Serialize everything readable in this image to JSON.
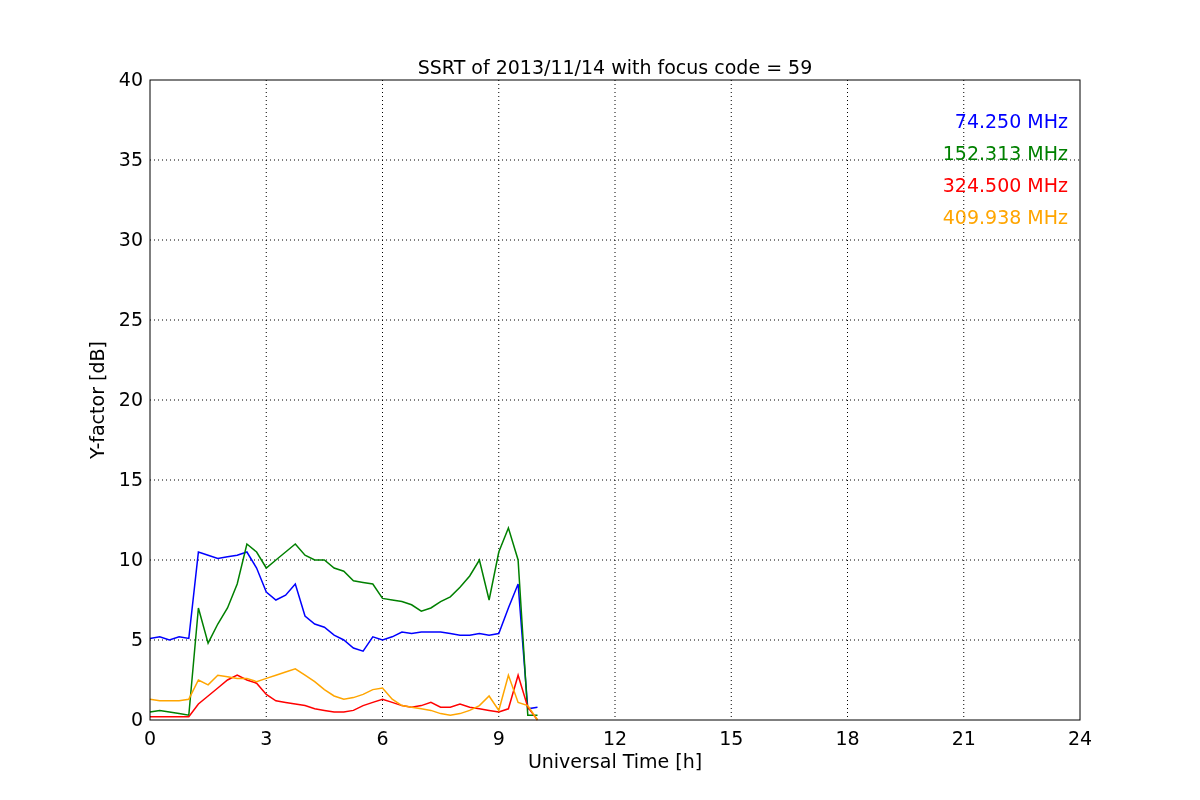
{
  "figure": {
    "chart_data": {
      "type": "line",
      "title": "SSRT of 2013/11/14 with focus code = 59",
      "xlabel": "Universal Time [h]",
      "ylabel": "Y-factor [dB]",
      "x": [
        0,
        0.25,
        0.5,
        0.75,
        1,
        1.25,
        1.5,
        1.75,
        2,
        2.25,
        2.5,
        2.75,
        3,
        3.25,
        3.5,
        3.75,
        4,
        4.25,
        4.5,
        4.75,
        5,
        5.25,
        5.5,
        5.75,
        6,
        6.25,
        6.5,
        6.75,
        7,
        7.25,
        7.5,
        7.75,
        8,
        8.25,
        8.5,
        8.75,
        9,
        9.25,
        9.5,
        9.75,
        10
      ],
      "series": [
        {
          "name": "74.250 MHz",
          "color": "#0000ff",
          "values": [
            5.1,
            5.2,
            5,
            5.2,
            5.1,
            10.5,
            10.3,
            10.1,
            10.2,
            10.3,
            10.5,
            9.5,
            8,
            7.5,
            7.8,
            8.5,
            6.5,
            6,
            5.8,
            5.3,
            5,
            4.5,
            4.3,
            5.2,
            5,
            5.2,
            5.5,
            5.4,
            5.5,
            5.5,
            5.5,
            5.4,
            5.3,
            5.3,
            5.4,
            5.3,
            5.4,
            7,
            8.5,
            0.7,
            0.8
          ]
        },
        {
          "name": "152.313 MHz",
          "color": "#008000",
          "values": [
            0.5,
            0.6,
            0.5,
            0.4,
            0.3,
            7,
            4.8,
            6,
            7,
            8.5,
            11,
            10.5,
            9.5,
            10,
            10.5,
            11,
            10.3,
            10,
            10,
            9.5,
            9.3,
            8.7,
            8.6,
            8.5,
            7.6,
            7.5,
            7.4,
            7.2,
            6.8,
            7,
            7.4,
            7.7,
            8.3,
            9,
            10,
            7.5,
            10.5,
            12,
            10,
            0.3,
            0.3
          ]
        },
        {
          "name": "324.500 MHz",
          "color": "#ff0000",
          "values": [
            0.2,
            0.2,
            0.2,
            0.2,
            0.2,
            1,
            1.5,
            2,
            2.5,
            2.8,
            2.5,
            2.3,
            1.6,
            1.2,
            1.1,
            1,
            0.9,
            0.7,
            0.6,
            0.5,
            0.5,
            0.6,
            0.9,
            1.1,
            1.3,
            1.1,
            0.9,
            0.8,
            0.9,
            1.1,
            0.8,
            0.8,
            1,
            0.8,
            0.7,
            0.6,
            0.5,
            0.7,
            2.8,
            0.8,
            0
          ]
        },
        {
          "name": "409.938 MHz",
          "color": "#ffa500",
          "values": [
            1.3,
            1.2,
            1.2,
            1.2,
            1.3,
            2.5,
            2.2,
            2.8,
            2.7,
            2.6,
            2.6,
            2.4,
            2.6,
            2.8,
            3,
            3.2,
            2.8,
            2.4,
            1.9,
            1.5,
            1.3,
            1.4,
            1.6,
            1.9,
            2,
            1.3,
            0.9,
            0.8,
            0.7,
            0.6,
            0.4,
            0.3,
            0.4,
            0.6,
            0.9,
            1.5,
            0.6,
            2.8,
            1.1,
            0.9,
            0
          ]
        }
      ],
      "grid": true,
      "xlim": [
        0,
        24
      ],
      "ylim": [
        0,
        40
      ],
      "xticks": [
        0,
        3,
        6,
        9,
        12,
        15,
        18,
        21,
        24
      ],
      "yticks": [
        0,
        5,
        10,
        15,
        20,
        25,
        30,
        35,
        40
      ]
    }
  }
}
